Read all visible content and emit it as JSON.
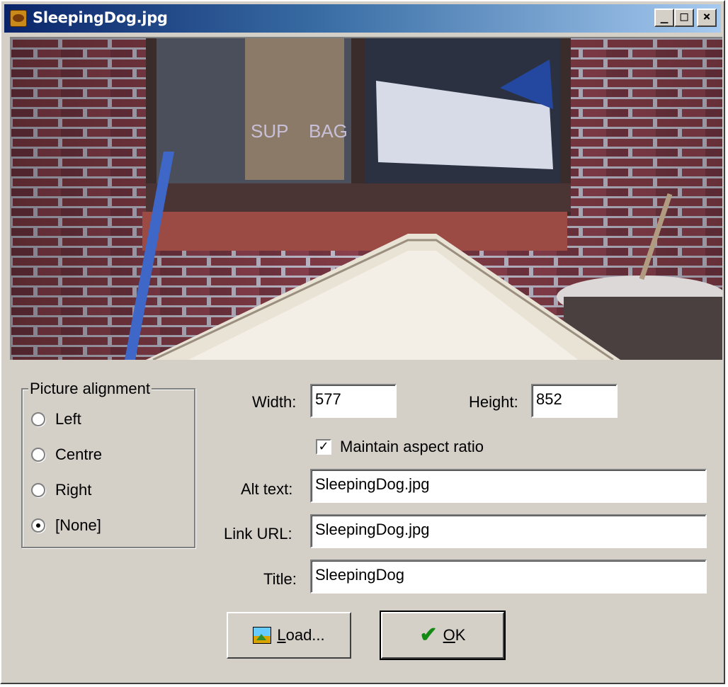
{
  "window": {
    "title": "SleepingDog.jpg",
    "buttons": {
      "minimize": "_",
      "maximize": "□",
      "close": "×"
    }
  },
  "preview": {
    "description_icon": "image-preview"
  },
  "alignment": {
    "legend": "Picture alignment",
    "options": [
      {
        "label": "Left",
        "selected": false
      },
      {
        "label": "Centre",
        "selected": false
      },
      {
        "label": "Right",
        "selected": false
      },
      {
        "label": "[None]",
        "selected": true
      }
    ]
  },
  "size": {
    "width_label": "Width:",
    "width_value": "577",
    "height_label": "Height:",
    "height_value": "852",
    "maintain_aspect_label": "Maintain aspect ratio",
    "maintain_aspect_checked": true
  },
  "fields": {
    "alt_label": "Alt text:",
    "alt_value": "SleepingDog.jpg",
    "link_label": "Link URL:",
    "link_value": "SleepingDog.jpg",
    "title_label": "Title:",
    "title_value": "SleepingDog"
  },
  "buttons": {
    "load_first": "L",
    "load_rest": "oad...",
    "ok_first": "O",
    "ok_rest": "K"
  }
}
